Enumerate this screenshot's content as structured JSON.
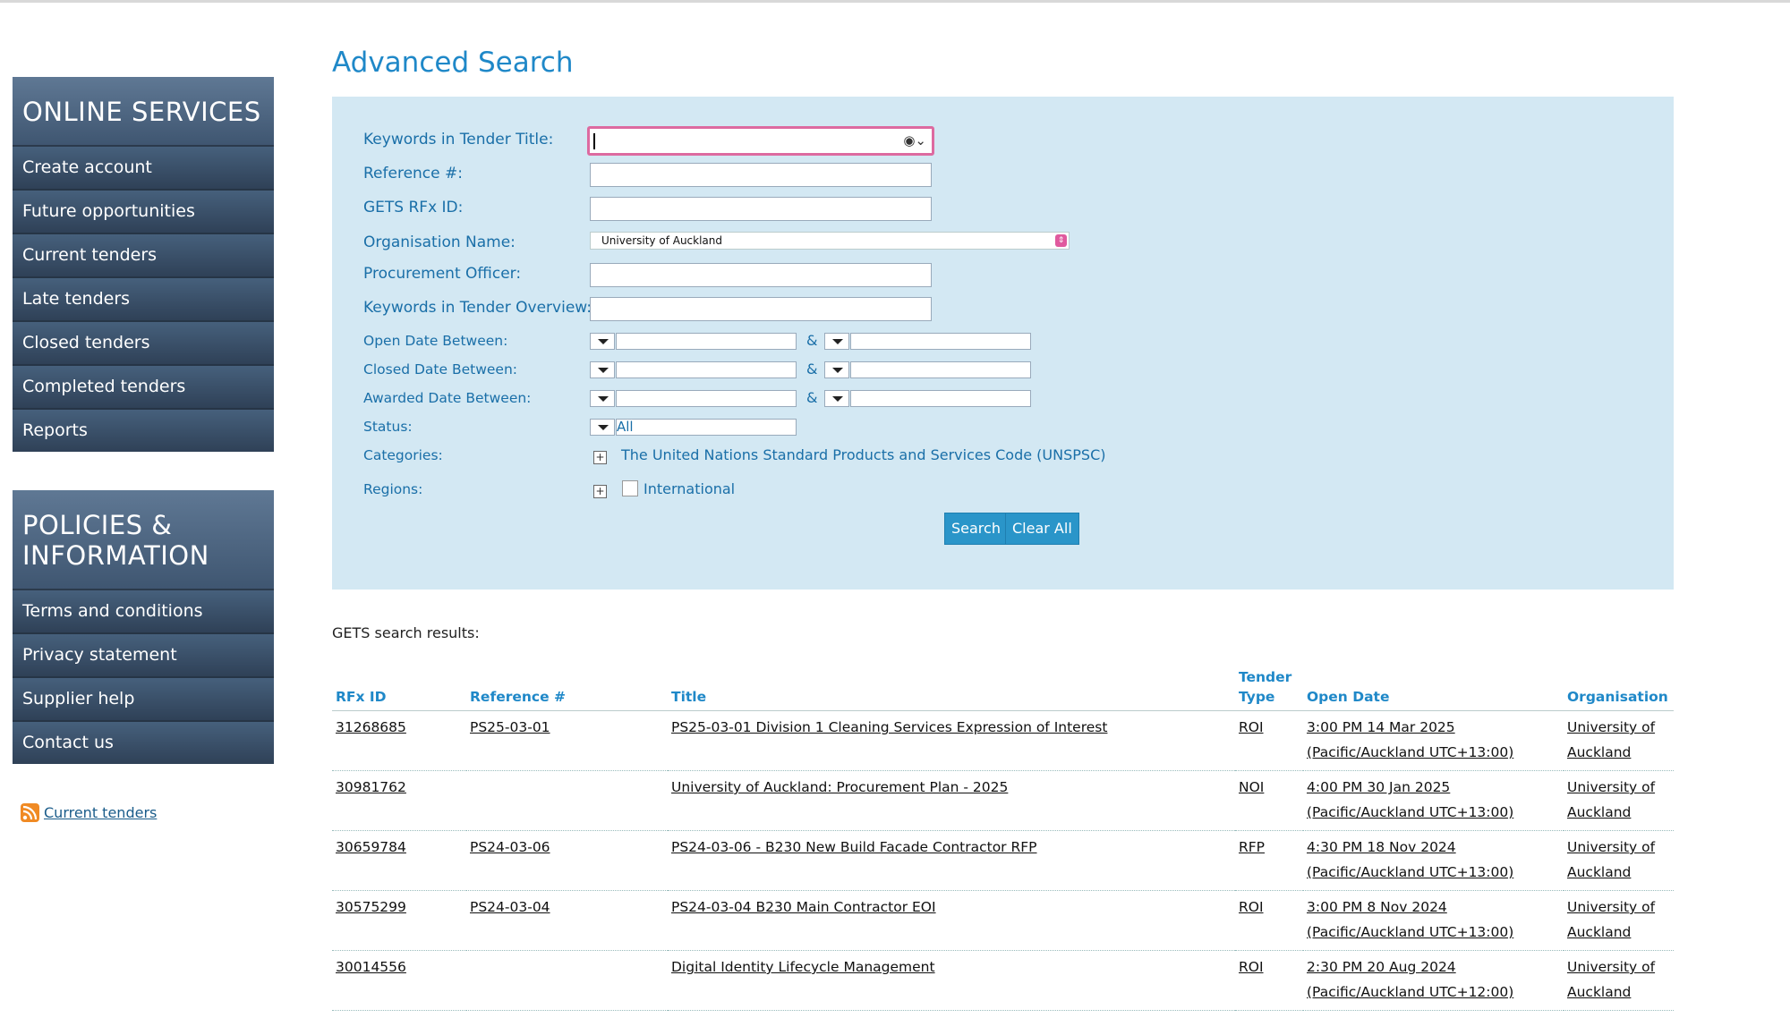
{
  "sidebar": {
    "online_services": {
      "heading": "ONLINE SERVICES",
      "items": [
        "Create account",
        "Future opportunities",
        "Current tenders",
        "Late tenders",
        "Closed tenders",
        "Completed tenders",
        "Reports"
      ]
    },
    "policies": {
      "heading_line1": "POLICIES &",
      "heading_line2": "INFORMATION",
      "items": [
        "Terms and conditions",
        "Privacy statement",
        "Supplier help",
        "Contact us"
      ]
    },
    "rss_link": "Current tenders"
  },
  "page_title": "Advanced Search",
  "form": {
    "keywords_title_label": "Keywords in Tender Title:",
    "keywords_title_value": "",
    "reference_label": "Reference #:",
    "rfx_id_label": "GETS RFx ID:",
    "organisation_label": "Organisation Name:",
    "organisation_value": "University of Auckland",
    "officer_label": "Procurement Officer:",
    "overview_label": "Keywords in Tender Overview:",
    "open_date_label": "Open Date Between:",
    "closed_date_label": "Closed Date Between:",
    "awarded_date_label": "Awarded Date Between:",
    "amp": "&",
    "status_label": "Status:",
    "status_value": "All",
    "categories_label": "Categories:",
    "categories_link": "The United Nations Standard Products and Services Code (UNSPSC)",
    "regions_label": "Regions:",
    "region_international": "International",
    "search_button": "Search",
    "clear_button": "Clear All"
  },
  "results": {
    "title": "GETS search results:",
    "columns": {
      "rfx": "RFx ID",
      "ref": "Reference #",
      "title": "Title",
      "type_line1": "Tender",
      "type_line2": "Type",
      "open": "Open Date",
      "org": "Organisation"
    },
    "rows": [
      {
        "rfx": "31268685",
        "ref": "PS25-03-01",
        "title": "PS25-03-01 Division 1 Cleaning Services Expression of Interest",
        "type": "ROI",
        "open_time": "3:00 PM 14 Mar 2025",
        "open_tz": "(Pacific/Auckland UTC+13:00)",
        "org1": "University of",
        "org2": "Auckland"
      },
      {
        "rfx": "30981762",
        "ref": "",
        "title": "University of Auckland: Procurement Plan - 2025",
        "type": "NOI",
        "open_time": "4:00 PM 30 Jan 2025",
        "open_tz": "(Pacific/Auckland UTC+13:00)",
        "org1": "University of",
        "org2": "Auckland"
      },
      {
        "rfx": "30659784",
        "ref": "PS24-03-06",
        "title": "PS24-03-06 - B230 New Build Facade Contractor RFP",
        "type": "RFP",
        "open_time": "4:30 PM 18 Nov 2024",
        "open_tz": "(Pacific/Auckland UTC+13:00)",
        "org1": "University of",
        "org2": "Auckland"
      },
      {
        "rfx": "30575299",
        "ref": "PS24-03-04",
        "title": "PS24-03-04 B230 Main Contractor EOI",
        "type": "ROI",
        "open_time": "3:00 PM 8 Nov 2024",
        "open_tz": "(Pacific/Auckland UTC+13:00)",
        "org1": "University of",
        "org2": "Auckland"
      },
      {
        "rfx": "30014556",
        "ref": "",
        "title": "Digital Identity Lifecycle Management",
        "type": "ROI",
        "open_time": "2:30 PM 20 Aug 2024",
        "open_tz": "(Pacific/Auckland UTC+12:00)",
        "org1": "University of",
        "org2": "Auckland"
      }
    ]
  }
}
